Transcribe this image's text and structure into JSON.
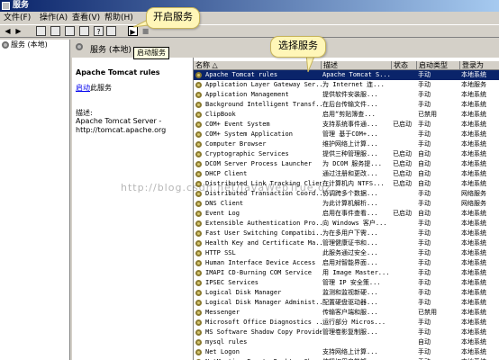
{
  "window": {
    "title": "服务"
  },
  "menu": [
    "文件(F)",
    "操作(A)",
    "查看(V)",
    "帮助(H)"
  ],
  "toolbar": {
    "tooltip": "启动服务"
  },
  "callouts": {
    "start": "开启服务",
    "select": "选择服务"
  },
  "tree": {
    "root": "服务 (本地)"
  },
  "pane": {
    "header": "服务 (本地)",
    "service_name": "Apache Tomcat rules",
    "start_link": "启动",
    "start_suffix": "此服务",
    "desc_label": "描述:",
    "desc_line1": "Apache Tomcat Server -",
    "desc_line2": "http://tomcat.apache.org"
  },
  "columns": [
    "名称 △",
    "描述",
    "状态",
    "启动类型",
    "登录为"
  ],
  "services": [
    [
      "Apache Tomcat rules",
      "Apache Tomcat S...",
      "",
      "手动",
      "本地系统"
    ],
    [
      "Application Layer Gateway Ser...",
      "为 Internet 连...",
      "",
      "手动",
      "本地服务"
    ],
    [
      "Application Management",
      "提供软件安装服...",
      "",
      "手动",
      "本地系统"
    ],
    [
      "Background Intelligent Transf...",
      "在后台传输文件...",
      "",
      "手动",
      "本地系统"
    ],
    [
      "ClipBook",
      "启用“剪贴簿查...",
      "",
      "已禁用",
      "本地系统"
    ],
    [
      "COM+ Event System",
      "支持系统事件通...",
      "已启动",
      "手动",
      "本地系统"
    ],
    [
      "COM+ System Application",
      "管理 基于COM+...",
      "",
      "手动",
      "本地系统"
    ],
    [
      "Computer Browser",
      "维护网络上计算...",
      "",
      "手动",
      "本地系统"
    ],
    [
      "Cryptographic Services",
      "提供三种管理服...",
      "已启动",
      "自动",
      "本地系统"
    ],
    [
      "DCOM Server Process Launcher",
      "为 DCOM 服务提...",
      "已启动",
      "自动",
      "本地系统"
    ],
    [
      "DHCP Client",
      "通过注册和更改...",
      "已启动",
      "自动",
      "本地系统"
    ],
    [
      "Distributed Link Tracking Client",
      "在计算机内 NTFS...",
      "已启动",
      "自动",
      "本地系统"
    ],
    [
      "Distributed Transaction Coord...",
      "协调跨多个数据...",
      "",
      "手动",
      "网络服务"
    ],
    [
      "DNS Client",
      "为此计算机解析...",
      "",
      "手动",
      "网络服务"
    ],
    [
      "Event Log",
      "启用在事件查看...",
      "已启动",
      "自动",
      "本地系统"
    ],
    [
      "Extensible Authentication Pro...",
      "向 Windows 客户...",
      "",
      "手动",
      "本地系统"
    ],
    [
      "Fast User Switching Compatibi...",
      "为在多用户下需...",
      "",
      "手动",
      "本地系统"
    ],
    [
      "Health Key and Certificate Ma...",
      "管理健康证书和...",
      "",
      "手动",
      "本地系统"
    ],
    [
      "HTTP SSL",
      "此服务通过安全...",
      "",
      "手动",
      "本地系统"
    ],
    [
      "Human Interface Device Access",
      "启用对智能界面...",
      "",
      "手动",
      "本地系统"
    ],
    [
      "IMAPI CD-Burning COM Service",
      "用 Image Master...",
      "",
      "手动",
      "本地系统"
    ],
    [
      "IPSEC Services",
      "管理 IP 安全策...",
      "",
      "手动",
      "本地系统"
    ],
    [
      "Logical Disk Manager",
      "监测和监视新硬...",
      "",
      "手动",
      "本地系统"
    ],
    [
      "Logical Disk Manager Administ...",
      "配置硬盘驱动器...",
      "",
      "手动",
      "本地系统"
    ],
    [
      "Messenger",
      "传输客户端和服...",
      "",
      "已禁用",
      "本地系统"
    ],
    [
      "Microsoft Office Diagnostics ...",
      "运行部分 Micros...",
      "",
      "手动",
      "本地系统"
    ],
    [
      "MS Software Shadow Copy Provider",
      "管理卷影复制服...",
      "",
      "手动",
      "本地系统"
    ],
    [
      "mysql rules",
      "",
      "",
      "自动",
      "本地系统"
    ],
    [
      "Net Logon",
      "支持网络上计算...",
      "",
      "手动",
      "本地系统"
    ],
    [
      "NetMeeting Remote Desktop Sha...",
      "使授权用户能够...",
      "",
      "手动",
      "本地系统"
    ]
  ],
  "watermark": "http://blog.csdn.net/JavaWebTrue,qz"
}
